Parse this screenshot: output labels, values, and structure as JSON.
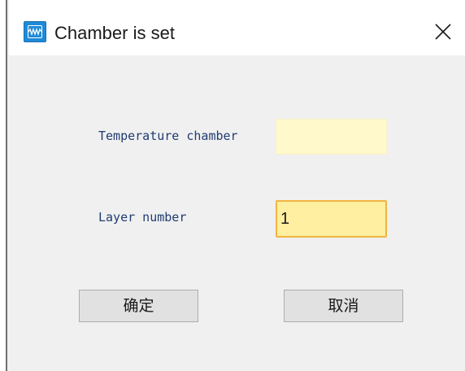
{
  "window": {
    "title": "Chamber is set",
    "icon": "app-waveform-icon",
    "close_icon": "close-icon"
  },
  "form": {
    "temperature_chamber": {
      "label": "Temperature chamber",
      "value": ""
    },
    "layer_number": {
      "label": "Layer number",
      "value": "1"
    }
  },
  "buttons": {
    "ok_label": "确定",
    "cancel_label": "取消"
  },
  "colors": {
    "label_text": "#1f3b73",
    "input_bg": "#fff9cc",
    "focused_input_bg": "#ffefa0",
    "focused_input_border": "#f2b441",
    "icon_blue": "#1e8ad8"
  }
}
